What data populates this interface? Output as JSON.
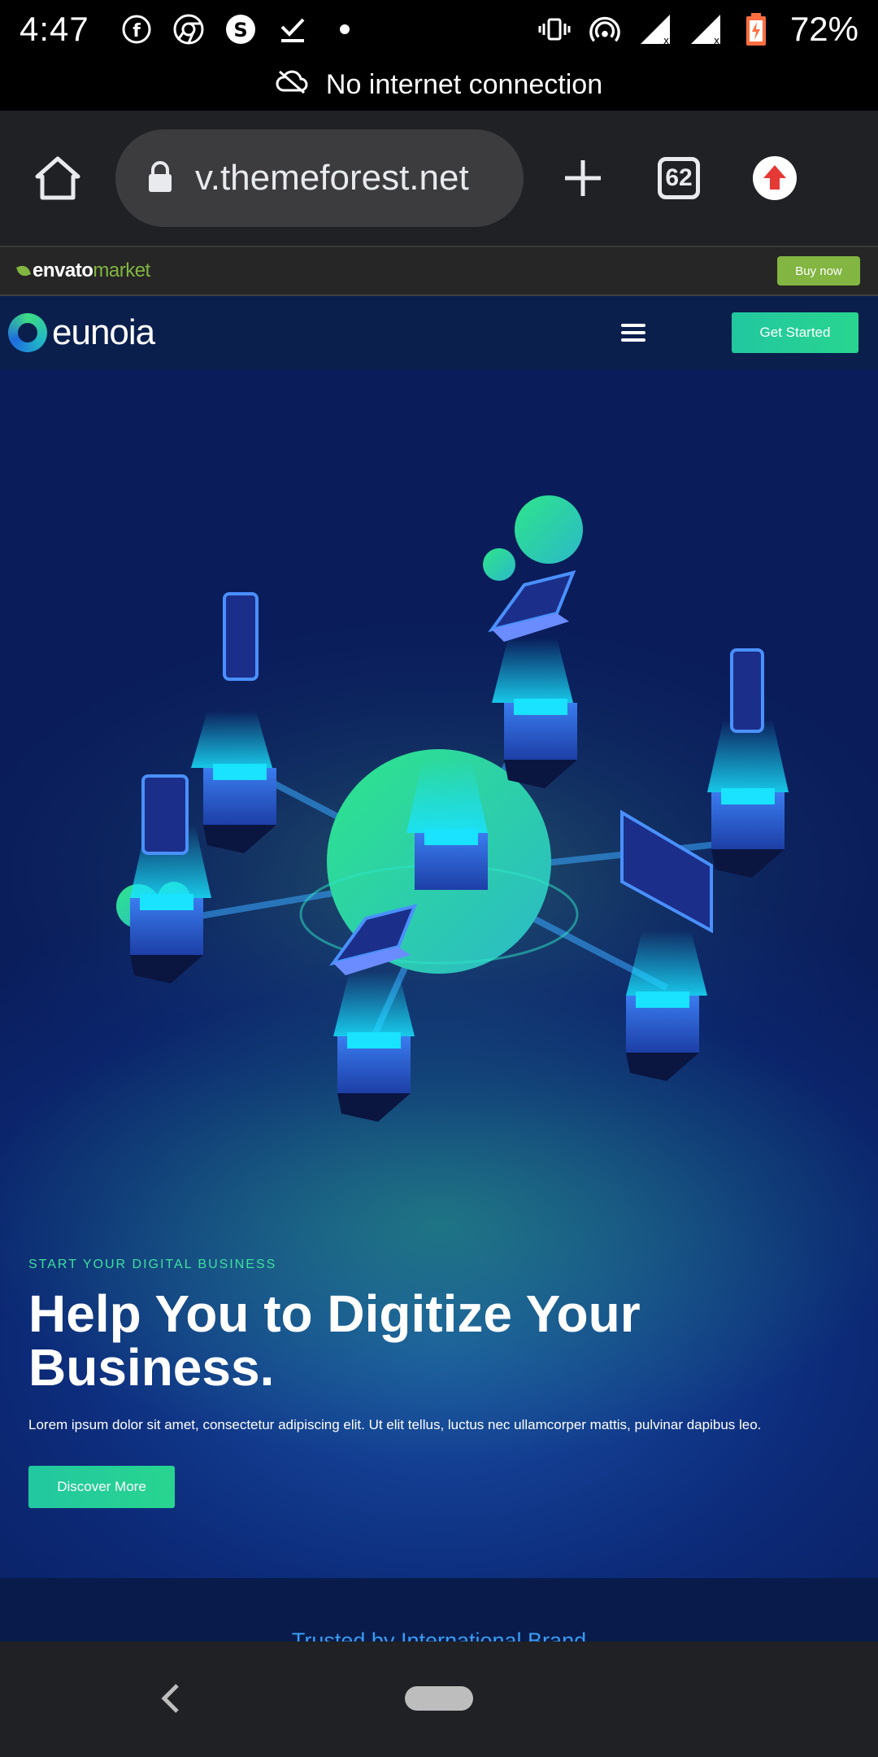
{
  "status_bar": {
    "time": "4:47",
    "battery": "72%",
    "left_icons": [
      "facebook-icon",
      "chrome-icon",
      "app-s-icon",
      "download-done-icon",
      "dot-icon"
    ],
    "right_icons": [
      "vibrate-icon",
      "hotspot-icon",
      "signal-icon",
      "signal-icon",
      "battery-icon"
    ]
  },
  "offline_banner": {
    "text": "No internet connection"
  },
  "browser": {
    "url": "v.themeforest.net",
    "tab_count": "62"
  },
  "envato": {
    "logo_bold": "envato",
    "logo_light": "market",
    "buy_label": "Buy now",
    "accent": "#82b541"
  },
  "site": {
    "logo_text": "eunoia",
    "cta_label": "Get Started",
    "accent": "#28d58f"
  },
  "hero": {
    "eyebrow": "START YOUR DIGITAL BUSINESS",
    "title": "Help You to Digitize Your Business.",
    "description": "Lorem ipsum dolor sit amet, consectetur adipiscing elit. Ut elit tellus, luctus nec ullamcorper mattis, pulvinar dapibus leo.",
    "button_label": "Discover More"
  },
  "trusted": {
    "text": "Trusted by International Brand"
  }
}
